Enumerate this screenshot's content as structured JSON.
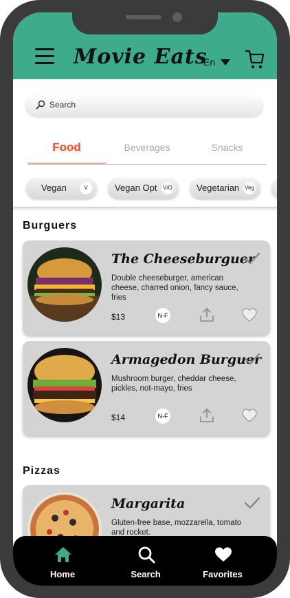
{
  "header": {
    "logo": "Movie Eats",
    "language": "En",
    "menu_icon": "hamburger-menu-icon",
    "cart_icon": "shopping-cart-icon",
    "color": "#3dab8c"
  },
  "search": {
    "placeholder": "Search",
    "icon": "search-icon"
  },
  "tabs": [
    {
      "label": "Food",
      "active": true
    },
    {
      "label": "Beverages",
      "active": false
    },
    {
      "label": "Snacks",
      "active": false
    }
  ],
  "filters": [
    {
      "label": "Vegan",
      "badge": "V"
    },
    {
      "label": "Vegan Opt",
      "badge": "V/O"
    },
    {
      "label": "Vegetarian",
      "badge": "Veg"
    }
  ],
  "sections": [
    {
      "title": "Burguers",
      "items": [
        {
          "name": "The Cheeseburguer",
          "description": "Double cheeseburger, american cheese, charred onion, fancy sauce, fries",
          "price": "$13",
          "tag": "N-F"
        },
        {
          "name": "Armagedon Burguer",
          "description": "Mushroom burger, cheddar cheese, pickles, not-mayo, fries",
          "price": "$14",
          "tag": "N-F"
        }
      ]
    },
    {
      "title": "Pizzas",
      "items": [
        {
          "name": "Margarita",
          "description": "Gluten-free base, mozzarella, tomato and rocket."
        }
      ]
    }
  ],
  "bottom_nav": [
    {
      "label": "Home",
      "icon": "home-icon",
      "color": "#3dab8c"
    },
    {
      "label": "Search",
      "icon": "search-icon",
      "color": "#ffffff"
    },
    {
      "label": "Favorites",
      "icon": "heart-icon",
      "color": "#ffffff"
    }
  ],
  "colors": {
    "accent": "#e5572f",
    "header": "#3dab8c",
    "card": "#d4d4d4",
    "frame": "#3b3b3b"
  }
}
